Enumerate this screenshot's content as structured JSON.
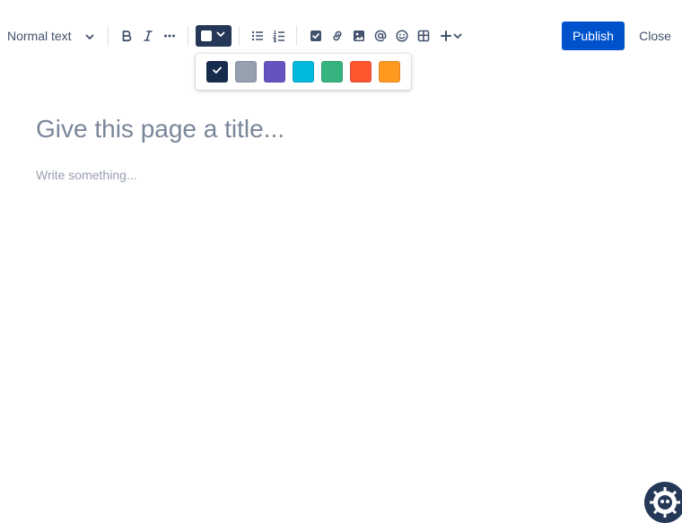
{
  "toolbar": {
    "text_style": {
      "label": "Normal text",
      "icon": "chevron-down-icon"
    },
    "formatting": [
      {
        "name": "bold-button",
        "icon": "bold-icon"
      },
      {
        "name": "italic-button",
        "icon": "italic-icon"
      },
      {
        "name": "more-formatting-button",
        "icon": "more-icon"
      }
    ],
    "text_color": {
      "current_color": "#ffffff",
      "button_bg": "#253858"
    },
    "lists": [
      {
        "name": "bullet-list-button",
        "icon": "bullet-list-icon"
      },
      {
        "name": "numbered-list-button",
        "icon": "numbered-list-icon"
      }
    ],
    "insert": [
      {
        "name": "action-item-button",
        "icon": "checkbox-icon"
      },
      {
        "name": "link-button",
        "icon": "link-icon"
      },
      {
        "name": "image-button",
        "icon": "image-icon"
      },
      {
        "name": "mention-button",
        "icon": "at-icon"
      },
      {
        "name": "emoji-button",
        "icon": "emoji-icon"
      },
      {
        "name": "table-button",
        "icon": "table-icon"
      },
      {
        "name": "insert-more-button",
        "icon": "plus-icon"
      }
    ],
    "publish_label": "Publish",
    "close_label": "Close",
    "accent": "#0052cc"
  },
  "color_palette": {
    "colors": [
      {
        "hex": "#172b4d",
        "selected": true
      },
      {
        "hex": "#97a0af",
        "selected": false
      },
      {
        "hex": "#6554c0",
        "selected": false
      },
      {
        "hex": "#00b8d9",
        "selected": false
      },
      {
        "hex": "#36b37e",
        "selected": false
      },
      {
        "hex": "#ff5630",
        "selected": false
      },
      {
        "hex": "#ff991f",
        "selected": false
      }
    ]
  },
  "editor": {
    "title_placeholder": "Give this page a title...",
    "body_placeholder": "Write something..."
  },
  "help_button": {
    "icon": "help-bot-icon"
  }
}
